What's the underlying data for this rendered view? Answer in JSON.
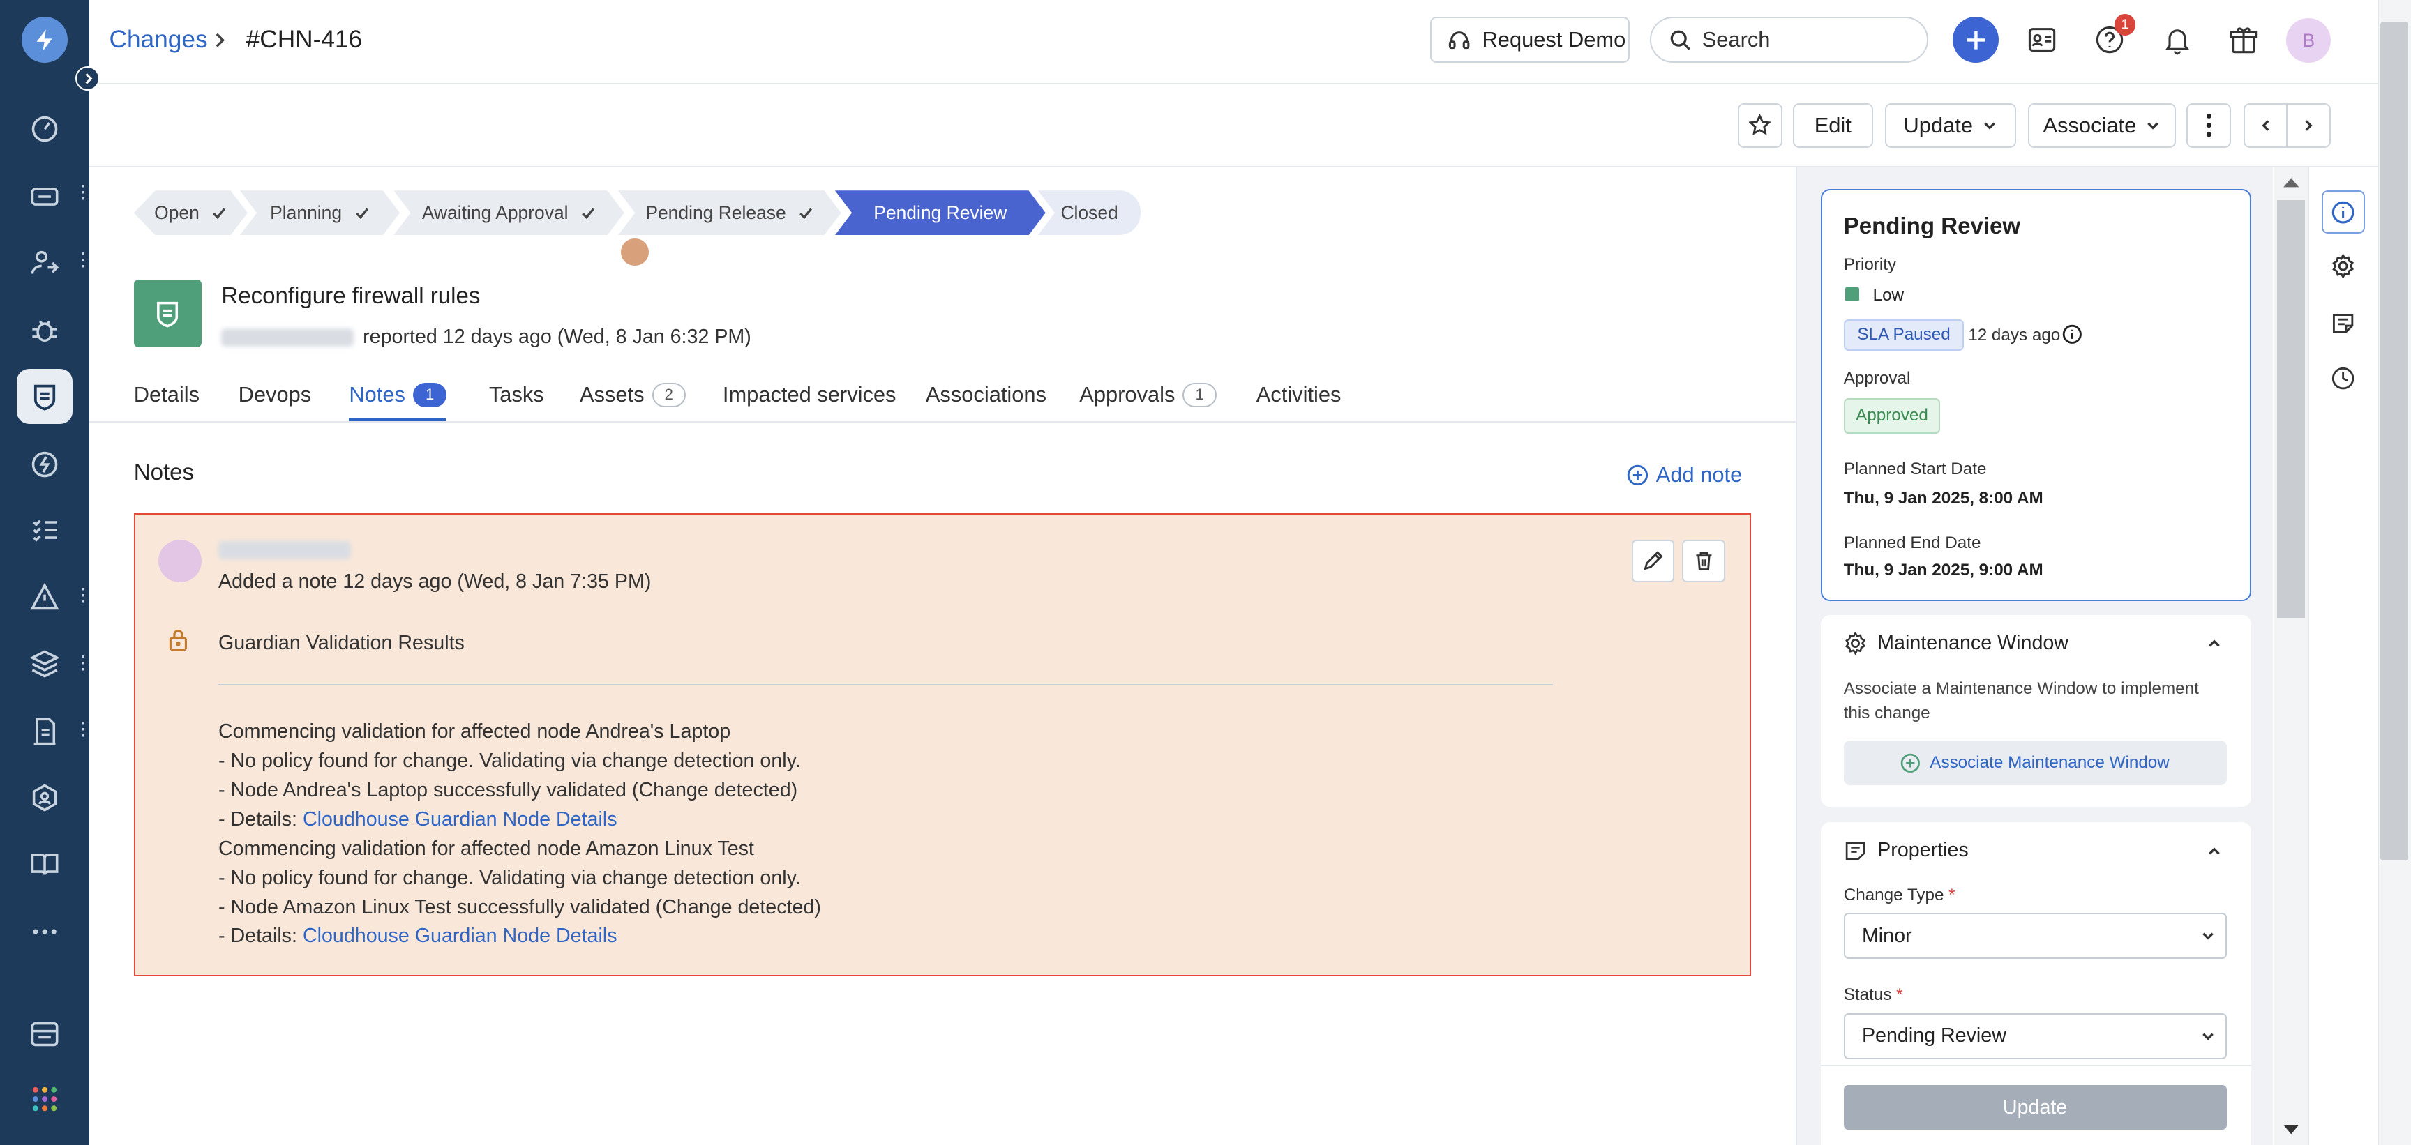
{
  "header": {
    "breadcrumb_link": "Changes",
    "breadcrumb_current": "#CHN-416",
    "request_demo": "Request Demo",
    "search_placeholder": "Search",
    "help_badge": "1",
    "avatar_initial": "B"
  },
  "toolbar": {
    "edit": "Edit",
    "update": "Update",
    "associate": "Associate"
  },
  "stages": [
    {
      "label": "Open",
      "done": true
    },
    {
      "label": "Planning",
      "done": true
    },
    {
      "label": "Awaiting Approval",
      "done": true
    },
    {
      "label": "Pending Release",
      "done": true
    },
    {
      "label": "Pending Review",
      "done": false,
      "active": true
    },
    {
      "label": "Closed",
      "done": false
    }
  ],
  "change": {
    "title": "Reconfigure firewall rules",
    "reported": "reported 12 days ago (Wed, 8 Jan 6:32 PM)"
  },
  "tabs": [
    {
      "label": "Details"
    },
    {
      "label": "Devops"
    },
    {
      "label": "Notes",
      "count": "1"
    },
    {
      "label": "Tasks"
    },
    {
      "label": "Assets",
      "count": "2"
    },
    {
      "label": "Impacted services"
    },
    {
      "label": "Associations"
    },
    {
      "label": "Approvals",
      "count": "1"
    },
    {
      "label": "Activities"
    }
  ],
  "notes": {
    "heading": "Notes",
    "add_note": "Add note",
    "note": {
      "meta": "Added a note 12 days ago (Wed, 8 Jan 7:35 PM)",
      "title": "Guardian Validation Results",
      "lines": [
        "Commencing validation for affected node Andrea's Laptop",
        "- No policy found for change. Validating via change detection only.",
        "- Node Andrea's Laptop successfully validated (Change detected)",
        "- Details: ",
        "Commencing validation for affected node Amazon Linux Test",
        "- No policy found for change. Validating via change detection only.",
        "- Node Amazon Linux Test successfully validated (Change detected)",
        "- Details: "
      ],
      "link_text": "Cloudhouse Guardian Node Details"
    }
  },
  "side": {
    "status_title": "Pending Review",
    "priority_label": "Priority",
    "priority_value": "Low",
    "priority_color": "#4fa07a",
    "sla_badge": "SLA Paused",
    "sla_time": "12 days ago",
    "approval_label": "Approval",
    "approval_value": "Approved",
    "start_label": "Planned Start Date",
    "start_value": "Thu, 9 Jan 2025, 8:00 AM",
    "end_label": "Planned End Date",
    "end_value": "Thu, 9 Jan 2025, 9:00 AM",
    "maintenance_title": "Maintenance Window",
    "maintenance_desc": "Associate a Maintenance Window to implement this change",
    "maintenance_btn": "Associate Maintenance Window",
    "properties_title": "Properties",
    "change_type_label": "Change Type",
    "change_type_value": "Minor",
    "status_label": "Status",
    "status_value": "Pending Review",
    "update_btn": "Update"
  },
  "colors": {
    "accent": "#3c64d3",
    "nav_bg": "#1e3a5a",
    "note_bg": "#f9e8da",
    "note_border": "#e34a3c"
  }
}
